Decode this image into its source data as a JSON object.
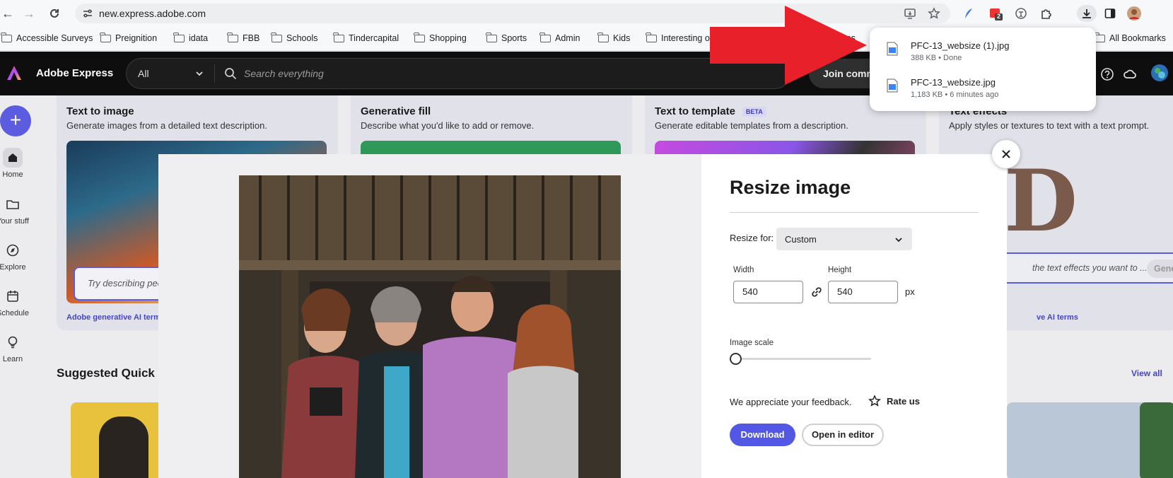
{
  "browser": {
    "url": "new.express.adobe.com",
    "extension_badge": "2"
  },
  "bookmarks": {
    "items": [
      "Accessible Surveys",
      "Preignition",
      "idata",
      "FBB",
      "Schools",
      "Tindercapital",
      "Shopping",
      "Sports",
      "Admin",
      "Kids",
      "Interesting o"
    ],
    "truncated_item": "ful res",
    "all_bookmarks": "All Bookmarks"
  },
  "downloads": {
    "items": [
      {
        "name": "PFC-13_websize (1).jpg",
        "meta": "388 KB • Done"
      },
      {
        "name": "PFC-13_websize.jpg",
        "meta": "1,183 KB • 6 minutes ago"
      }
    ]
  },
  "header": {
    "brand": "Adobe Express",
    "filter_value": "All",
    "search_placeholder": "Search everything",
    "join_label": "Join comm"
  },
  "rail": {
    "items": [
      "Home",
      "Your stuff",
      "Explore",
      "Schedule",
      "Learn"
    ]
  },
  "cards": [
    {
      "title": "Text to image",
      "desc": "Generate images from a detailed text description.",
      "prompt": "Try describing peo",
      "terms": "Adobe generative AI terms"
    },
    {
      "title": "Generative fill",
      "desc": "Describe what you'd like to add or remove."
    },
    {
      "title": "Text to template",
      "badge": "BETA",
      "desc": "Generate editable templates from a description."
    },
    {
      "title": "Text effects",
      "desc": "Apply styles or textures to text with a text prompt.",
      "prompt": "the text effects you want to ...",
      "generate": "Gener",
      "terms": "ve AI terms"
    }
  ],
  "suggested": {
    "title": "Suggested Quick ac",
    "view_all": "View all"
  },
  "modal": {
    "title": "Resize image",
    "resize_for_label": "Resize for:",
    "resize_for_value": "Custom",
    "width_label": "Width",
    "width_value": "540",
    "height_label": "Height",
    "height_value": "540",
    "unit": "px",
    "scale_label": "Image scale",
    "scale_value": 0,
    "feedback_text": "We appreciate your feedback.",
    "rate_label": "Rate us",
    "download_label": "Download",
    "open_editor_label": "Open in editor"
  },
  "colors": {
    "accent": "#5258e4",
    "arrow": "#e8202a",
    "header_bg": "#0e0e0e"
  }
}
